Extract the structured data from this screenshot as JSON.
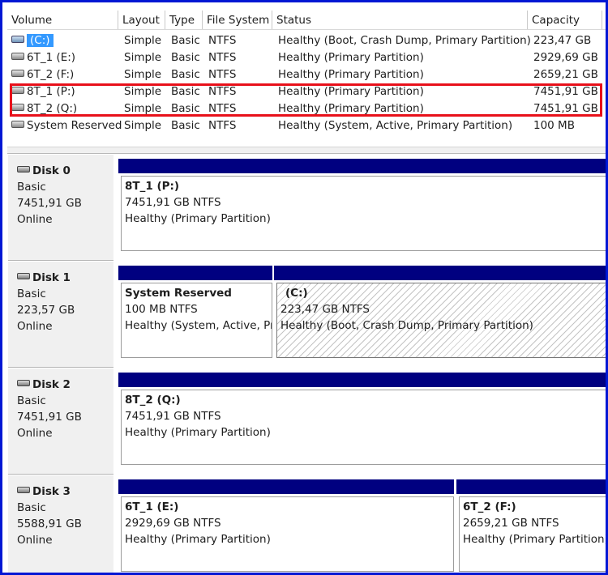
{
  "volume_list": {
    "columns": [
      "Volume",
      "Layout",
      "Type",
      "File System",
      "Status",
      "Capacity"
    ],
    "rows": [
      {
        "volume": "(C:)",
        "layout": "Simple",
        "type": "Basic",
        "fs": "NTFS",
        "status": "Healthy (Boot, Crash Dump, Primary Partition)",
        "capacity": "223,47 GB",
        "selected": true
      },
      {
        "volume": "6T_1 (E:)",
        "layout": "Simple",
        "type": "Basic",
        "fs": "NTFS",
        "status": "Healthy (Primary Partition)",
        "capacity": "2929,69 GB"
      },
      {
        "volume": "6T_2 (F:)",
        "layout": "Simple",
        "type": "Basic",
        "fs": "NTFS",
        "status": "Healthy (Primary Partition)",
        "capacity": "2659,21 GB"
      },
      {
        "volume": "8T_1 (P:)",
        "layout": "Simple",
        "type": "Basic",
        "fs": "NTFS",
        "status": "Healthy (Primary Partition)",
        "capacity": "7451,91 GB"
      },
      {
        "volume": "8T_2 (Q:)",
        "layout": "Simple",
        "type": "Basic",
        "fs": "NTFS",
        "status": "Healthy (Primary Partition)",
        "capacity": "7451,91 GB"
      },
      {
        "volume": "System Reserved",
        "layout": "Simple",
        "type": "Basic",
        "fs": "NTFS",
        "status": "Healthy (System, Active, Primary Partition)",
        "capacity": "100 MB"
      }
    ]
  },
  "disks": [
    {
      "name": "Disk 0",
      "type": "Basic",
      "size": "7451,91 GB",
      "state": "Online",
      "partitions": [
        {
          "name": "8T_1  (P:)",
          "size": "7451,91 GB NTFS",
          "status": "Healthy (Primary Partition)"
        }
      ]
    },
    {
      "name": "Disk 1",
      "type": "Basic",
      "size": "223,57 GB",
      "state": "Online",
      "partitions": [
        {
          "name": "System Reserved",
          "size": "100 MB NTFS",
          "status": "Healthy (System, Active, Pri"
        },
        {
          "name": "(C:)",
          "size": "223,47 GB NTFS",
          "status": "Healthy (Boot, Crash Dump, Primary Partition)"
        }
      ]
    },
    {
      "name": "Disk 2",
      "type": "Basic",
      "size": "7451,91 GB",
      "state": "Online",
      "partitions": [
        {
          "name": "8T_2  (Q:)",
          "size": "7451,91 GB NTFS",
          "status": "Healthy (Primary Partition)"
        }
      ]
    },
    {
      "name": "Disk 3",
      "type": "Basic",
      "size": "5588,91 GB",
      "state": "Online",
      "partitions": [
        {
          "name": "6T_1  (E:)",
          "size": "2929,69 GB NTFS",
          "status": "Healthy (Primary Partition)"
        },
        {
          "name": "6T_2  (F:)",
          "size": "2659,21 GB NTFS",
          "status": "Healthy (Primary Partition)"
        }
      ]
    }
  ],
  "colors": {
    "partition_bar": "#000080",
    "highlight": "#e8101a",
    "frame": "#0017d4",
    "selection": "#3399ff"
  },
  "icons": {
    "volume": "drive-icon",
    "disk": "disk-drive-icon"
  }
}
